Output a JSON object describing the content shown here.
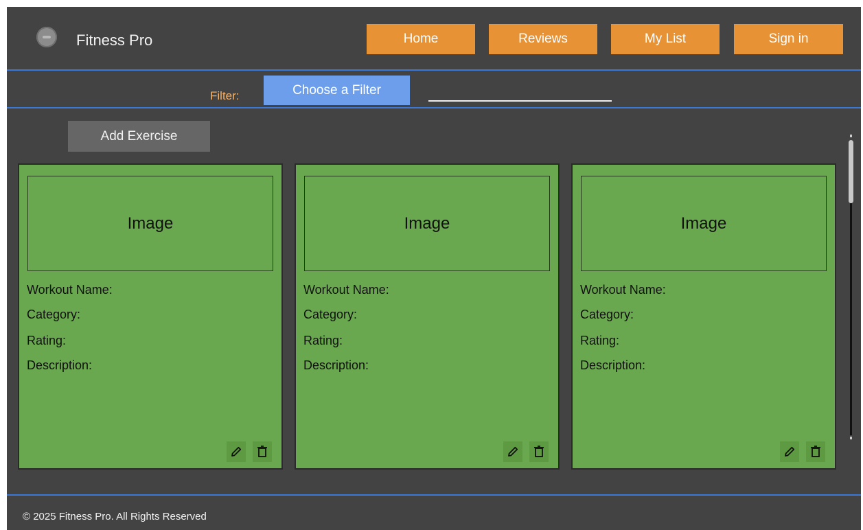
{
  "header": {
    "app_title": "Fitness Pro",
    "logo_icon": "logo-icon",
    "nav": [
      {
        "label": "Home"
      },
      {
        "label": "Reviews"
      },
      {
        "label": "My List"
      },
      {
        "label": "Sign in"
      }
    ]
  },
  "filter": {
    "label": "Filter:",
    "button_label": "Choose a Filter",
    "input_value": "",
    "input_placeholder": ""
  },
  "actions": {
    "add_exercise_label": "Add Exercise"
  },
  "cards": [
    {
      "image_label": "Image",
      "workout_name_label": "Workout Name:",
      "category_label": "Category:",
      "rating_label": "Rating:",
      "description_label": "Description:"
    },
    {
      "image_label": "Image",
      "workout_name_label": "Workout Name:",
      "category_label": "Category:",
      "rating_label": "Rating:",
      "description_label": "Description:"
    },
    {
      "image_label": "Image",
      "workout_name_label": "Workout Name:",
      "category_label": "Category:",
      "rating_label": "Rating:",
      "description_label": "Description:"
    }
  ],
  "card_icons": [
    "pencil-icon",
    "trash-icon"
  ],
  "footer": {
    "copyright": "© 2025 Fitness Pro. All Rights Reserved"
  },
  "colors": {
    "background": "#434343",
    "nav_button": "#e69235",
    "filter_button": "#6d9eeb",
    "filter_label": "#f6b26b",
    "card": "#6aa84f",
    "add_button": "#666666",
    "divider": "#3c78d8"
  }
}
